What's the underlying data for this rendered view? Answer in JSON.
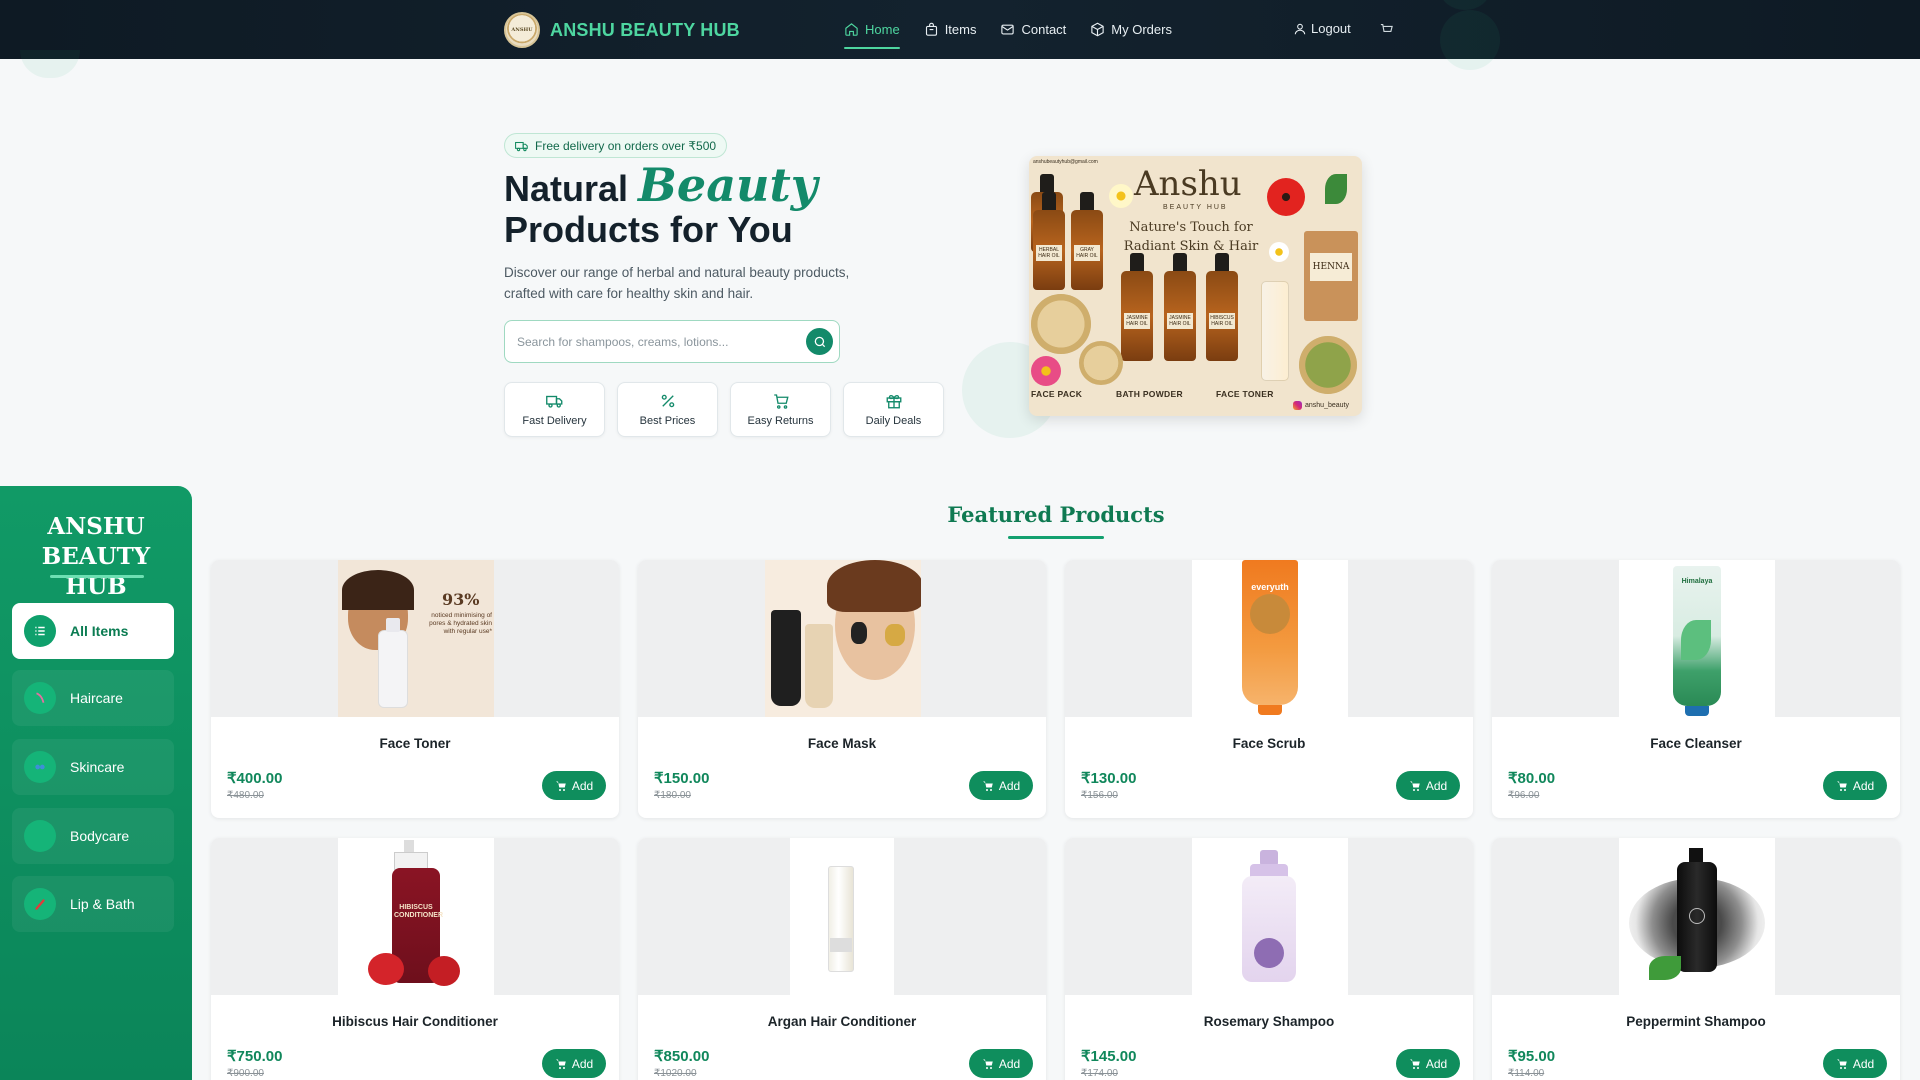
{
  "brand": {
    "name": "ANSHU BEAUTY HUB",
    "logo_text": "ANSHU"
  },
  "nav": {
    "links": [
      {
        "label": "Home",
        "icon": "home-icon",
        "active": true
      },
      {
        "label": "Items",
        "icon": "bag-icon",
        "active": false
      },
      {
        "label": "Contact",
        "icon": "mail-icon",
        "active": false
      },
      {
        "label": "My Orders",
        "icon": "box-icon",
        "active": false
      }
    ],
    "logout": "Logout",
    "cart_icon": "cart-icon"
  },
  "hero": {
    "badge": "Free delivery on orders over ₹500",
    "title_part1": "Natural",
    "title_highlight": "Beauty",
    "title_part2": "Products for You",
    "description": "Discover our range of herbal and natural beauty products, crafted with care for healthy skin and hair.",
    "search_placeholder": "Search for shampoos, creams, lotions...",
    "features": [
      "Fast Delivery",
      "Best Prices",
      "Easy Returns",
      "Daily Deals"
    ]
  },
  "banner": {
    "email": "anshubeautyhub@gmail.com",
    "title": "Anshu",
    "subtitle": "BEAUTY HUB",
    "tagline": "Nature's Touch for Radiant Skin & Hair",
    "bottle_labels": [
      "HERBAL HAIR OIL",
      "GRAY HAIR OIL",
      "JASMINE HAIR OIL",
      "JASMINE HAIR OIL",
      "HIBISCUS HAIR OIL"
    ],
    "henna": "HENNA",
    "labels": [
      "FACE PACK",
      "BATH POWDER",
      "FACE TONER"
    ],
    "handle": "anshu_beauty"
  },
  "sidebar": {
    "title": "ANSHU BEAUTY HUB",
    "items": [
      {
        "label": "All Items",
        "active": true
      },
      {
        "label": "Haircare",
        "active": false
      },
      {
        "label": "Skincare",
        "active": false
      },
      {
        "label": "Bodycare",
        "active": false
      },
      {
        "label": "Lip & Bath",
        "active": false
      }
    ]
  },
  "featured": {
    "title": "Featured Products",
    "add_label": "Add",
    "products": [
      {
        "name": "Face Toner",
        "price": "₹400.00",
        "old_price": "₹480.00",
        "image_text": "93%",
        "image_caption": "noticed minimising of pores & hydrated skin with regular use*"
      },
      {
        "name": "Face Mask",
        "price": "₹150.00",
        "old_price": "₹180.00"
      },
      {
        "name": "Face Scrub",
        "price": "₹130.00",
        "old_price": "₹156.00",
        "image_text": "everyuth"
      },
      {
        "name": "Face Cleanser",
        "price": "₹80.00",
        "old_price": "₹96.00",
        "image_text": "Himalaya"
      },
      {
        "name": "Hibiscus Hair Conditioner",
        "price": "₹750.00",
        "old_price": "₹900.00",
        "image_text": "HIBISCUS CONDITIONER"
      },
      {
        "name": "Argan Hair Conditioner",
        "price": "₹850.00",
        "old_price": "₹1020.00"
      },
      {
        "name": "Rosemary Shampoo",
        "price": "₹145.00",
        "old_price": "₹174.00"
      },
      {
        "name": "Peppermint Shampoo",
        "price": "₹95.00",
        "old_price": "₹114.00"
      }
    ]
  },
  "colors": {
    "accent": "#0f8e5d",
    "brand_green": "#4ed6a0",
    "navbar": "#0e1a24",
    "sidebar": "#119a66"
  }
}
